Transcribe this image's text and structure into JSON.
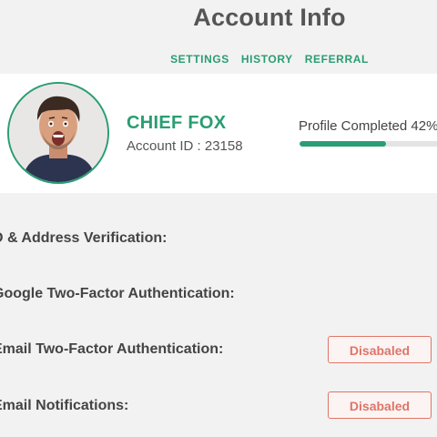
{
  "header": {
    "title": "Account Info"
  },
  "tabs": [
    {
      "label": "SETTINGS"
    },
    {
      "label": "HISTORY"
    },
    {
      "label": "REFERRAL"
    }
  ],
  "profile": {
    "name": "CHIEF FOX",
    "account_id": "Account ID : 23158",
    "progress_label": "Profile Completed 42%",
    "progress_percent": 42
  },
  "settings": [
    {
      "label": "D & Address Verification:"
    },
    {
      "label": "Google Two-Factor Authentication:"
    },
    {
      "label": "Email Two-Factor Authentication:",
      "button": "Disabaled"
    },
    {
      "label": "Email Notifications:",
      "button": "Disabaled"
    }
  ],
  "colors": {
    "accent": "#2a9d73",
    "danger": "#e07468",
    "background": "#f2f2f2"
  }
}
